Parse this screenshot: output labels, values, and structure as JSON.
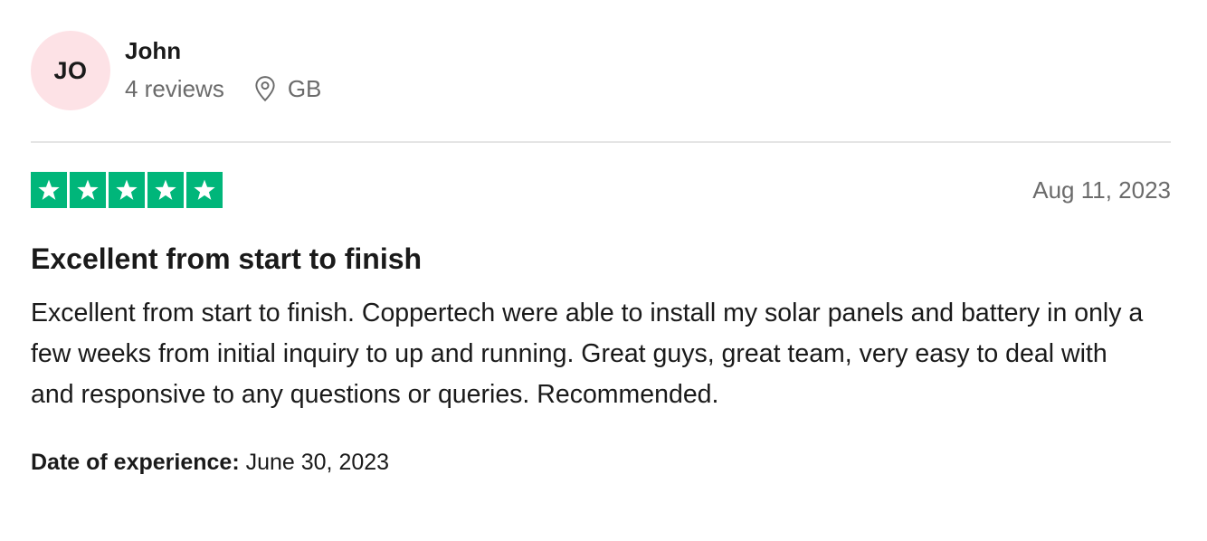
{
  "reviewer": {
    "initials": "JO",
    "name": "John",
    "reviews_count": "4 reviews",
    "country": "GB",
    "avatar_color": "#fde2e6"
  },
  "rating": {
    "stars": 5,
    "max_stars": 5,
    "star_color": "#00b67a"
  },
  "review": {
    "date": "Aug 11, 2023",
    "title": "Excellent from start to finish",
    "body": "Excellent from start to finish. Coppertech were able to install my solar panels and battery in only a few weeks from initial inquiry to up and running. Great guys, great team, very easy to deal with and responsive to any questions or queries. Recommended.",
    "experience_label": "Date of experience:",
    "experience_date": "June 30, 2023"
  },
  "icons": {
    "location": "location-pin-icon",
    "star": "star-icon"
  }
}
